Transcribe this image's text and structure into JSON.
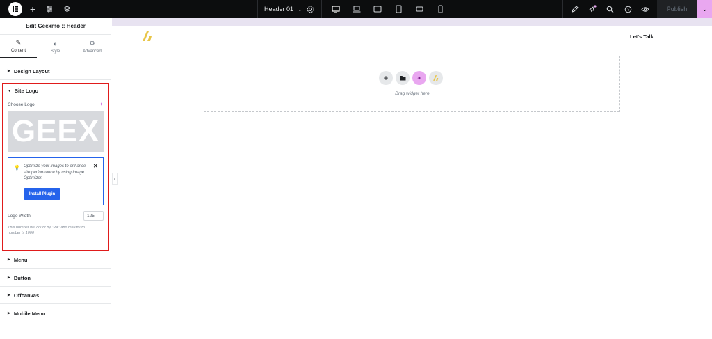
{
  "topbar": {
    "document_name": "Header 01",
    "publish_label": "Publish",
    "icons": [
      "elementor-logo-icon",
      "plus-icon",
      "sliders-icon",
      "layers-icon",
      "chevron-down-icon",
      "gear-icon",
      "desktop-icon",
      "laptop-icon",
      "tablet-landscape-icon",
      "tablet-portrait-icon",
      "mobile-landscape-icon",
      "mobile-portrait-icon",
      "pen-icon",
      "notifications-icon",
      "search-icon",
      "help-icon",
      "eye-icon"
    ],
    "accent_color": "#e9a7f0"
  },
  "sidebar": {
    "title": "Edit Geexmo :: Header",
    "tabs": [
      {
        "label": "Content",
        "icon": "pencil-icon"
      },
      {
        "label": "Style",
        "icon": "half-circle-icon"
      },
      {
        "label": "Advanced",
        "icon": "gear-icon"
      }
    ],
    "sections_top": [
      {
        "label": "Design Layout"
      }
    ],
    "site_logo": {
      "label": "Site Logo",
      "choose_logo_label": "Choose Logo",
      "logo_preview_text": "GEEX",
      "notice_text": "Optimize your images to enhance site performance by using Image Optimizer.",
      "install_label": "Install Plugin",
      "logo_width_label": "Logo Width",
      "logo_width_value": "125",
      "logo_width_help": "This number will count by \"PX\" and maximum number is 1000"
    },
    "sections_bottom": [
      {
        "label": "Menu"
      },
      {
        "label": "Button"
      },
      {
        "label": "Offcanvas"
      },
      {
        "label": "Mobile Menu"
      }
    ]
  },
  "canvas": {
    "cta_text": "Let's Talk",
    "drag_text": "Drag widget here",
    "brand_color": "#e8c547"
  }
}
